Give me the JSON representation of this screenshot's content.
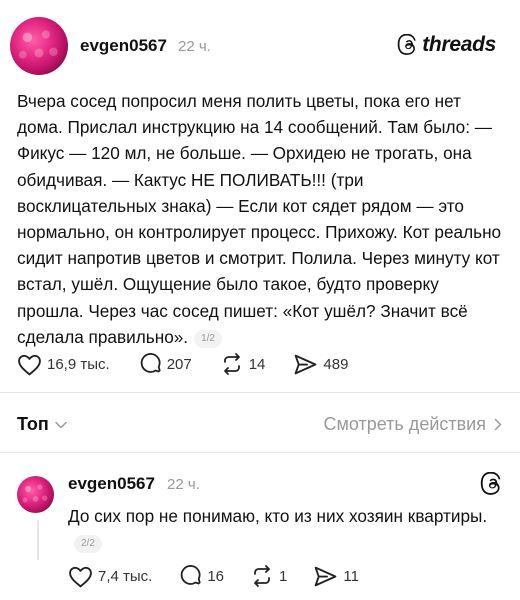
{
  "post": {
    "author": "evgen0567",
    "time": "22 ч.",
    "brand": "threads",
    "text": "Вчера сосед попросил меня полить цветы, пока его нет дома. Прислал инструкцию на 14 сообщений. Там было: — Фикус — 120 мл, не больше. — Орхидею не трогать, она обидчивая. — Кактус НЕ ПОЛИВАТЬ!!! (три восклицательных знака) — Если кот сядет рядом — это нормально, он контролирует процесс. Прихожу. Кот реально сидит напротив цветов и смотрит. Полила. Через минуту кот встал, ушёл. Ощущение было такое, будто проверку прошла. Через час сосед пишет: «Кот ушёл? Значит всё сделала правильно».",
    "pager": "1/2",
    "likes": "16,9 тыс.",
    "comments": "207",
    "reposts": "14",
    "shares": "489"
  },
  "sort": {
    "label": "Топ",
    "activity": "Смотреть действия"
  },
  "reply": {
    "author": "evgen0567",
    "time": "22 ч.",
    "text": "До сих пор не понимаю, кто из них хозяин квартиры.",
    "pager": "2/2",
    "likes": "7,4 тыс.",
    "comments": "16",
    "reposts": "1",
    "shares": "11"
  },
  "colors": {
    "text": "#111111",
    "muted": "#999999",
    "divider": "#e5e5e5",
    "avatar_pink": "#e62b86"
  }
}
